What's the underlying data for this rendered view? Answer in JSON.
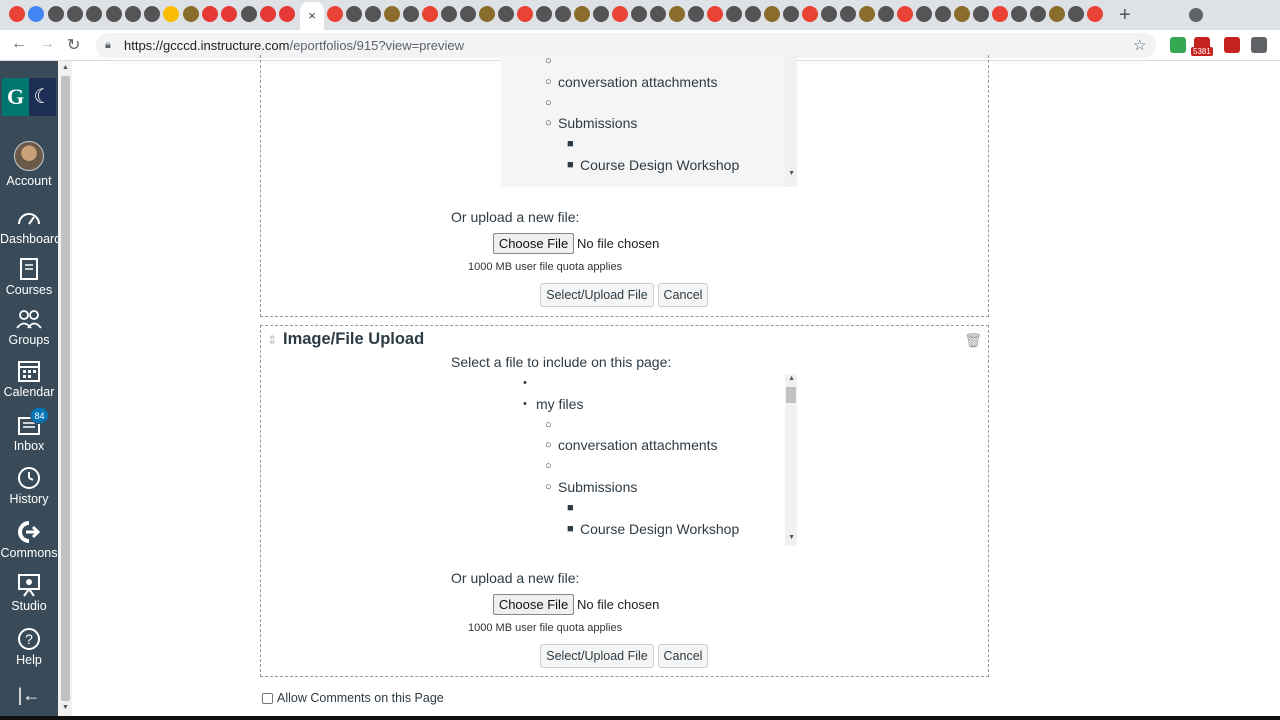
{
  "browser": {
    "active_tab_close": "×",
    "new_tab": "+",
    "url_host": "https://gcccd.instructure.com",
    "url_path": "/eportfolios/915?view=preview",
    "extension_badge": "5381",
    "tab_colors": [
      "#ea4335",
      "#4285f4",
      "#555",
      "#555",
      "#555",
      "#555",
      "#555",
      "#555",
      "#fbbc04",
      "#8a6d2c",
      "#e53935",
      "#e53935",
      "#555",
      "#e53935",
      "#e53935"
    ],
    "extension_colors": [
      "#34a853",
      "#c5221f",
      "#c5221f",
      "#555"
    ]
  },
  "global_nav": {
    "logo_left": "G",
    "logo_right": "☾",
    "items": [
      {
        "label": "Account"
      },
      {
        "label": "Dashboard"
      },
      {
        "label": "Courses"
      },
      {
        "label": "Groups"
      },
      {
        "label": "Calendar"
      },
      {
        "label": "Inbox",
        "badge": "84"
      },
      {
        "label": "History"
      },
      {
        "label": "Commons"
      },
      {
        "label": "Studio"
      },
      {
        "label": "Help"
      }
    ],
    "collapse_icon": "|←"
  },
  "section1": {
    "tree": [
      {
        "text": "",
        "bullet": "○"
      },
      {
        "text": "conversation attachments",
        "bullet": "○"
      },
      {
        "text": "",
        "bullet": "○"
      },
      {
        "text": "Submissions",
        "bullet": "○"
      },
      {
        "text": "",
        "bullet": "■"
      },
      {
        "text": "Course Design Workshop",
        "bullet": "■"
      }
    ],
    "upload_label": "Or upload a new file:",
    "choose_file": "Choose File",
    "no_file": "No file chosen",
    "quota": "1000 MB user file quota applies",
    "select_upload": "Select/Upload File",
    "cancel": "Cancel"
  },
  "section2": {
    "title": "Image/File Upload",
    "select_label": "Select a file to include on this page:",
    "tree": [
      {
        "text": "",
        "bullet": "•"
      },
      {
        "text": "my files",
        "bullet": "•"
      },
      {
        "text": "",
        "bullet": "○"
      },
      {
        "text": "conversation attachments",
        "bullet": "○"
      },
      {
        "text": "",
        "bullet": "○"
      },
      {
        "text": "Submissions",
        "bullet": "○"
      },
      {
        "text": "",
        "bullet": "■"
      },
      {
        "text": "Course Design Workshop",
        "bullet": "■"
      }
    ],
    "upload_label": "Or upload a new file:",
    "choose_file": "Choose File",
    "no_file": "No file chosen",
    "quota": "1000 MB user file quota applies",
    "select_upload": "Select/Upload File",
    "cancel": "Cancel"
  },
  "allow_comments": "Allow Comments on this Page"
}
